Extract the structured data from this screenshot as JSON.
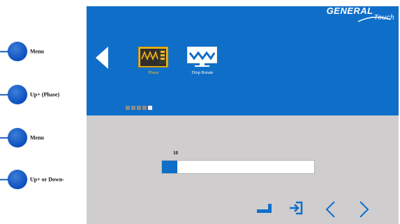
{
  "legend": {
    "items": [
      {
        "label": "Menu"
      },
      {
        "label": "Up+ (Phase)"
      },
      {
        "label": "Menu"
      },
      {
        "label": "Up+ or Down-"
      }
    ]
  },
  "osd": {
    "brand": {
      "main": "GENERAL",
      "sub": "Touch"
    },
    "icons": [
      {
        "label": "Phase",
        "selected": true,
        "icon": "phase-waveform-icon"
      },
      {
        "label": "Disp Rotate",
        "selected": false,
        "icon": "display-rotate-icon"
      }
    ],
    "page_indicator": {
      "total": 5,
      "current": 5
    },
    "slider": {
      "value": "10",
      "level_fraction": 0.1
    },
    "controls": [
      "enter-icon",
      "exit-icon",
      "previous-icon",
      "next-icon"
    ]
  },
  "colors": {
    "osd_blue": "#0f6fc8",
    "osd_gray": "#cfcdce",
    "selected_caption": "#f3b81a",
    "caption": "#ffffff"
  }
}
